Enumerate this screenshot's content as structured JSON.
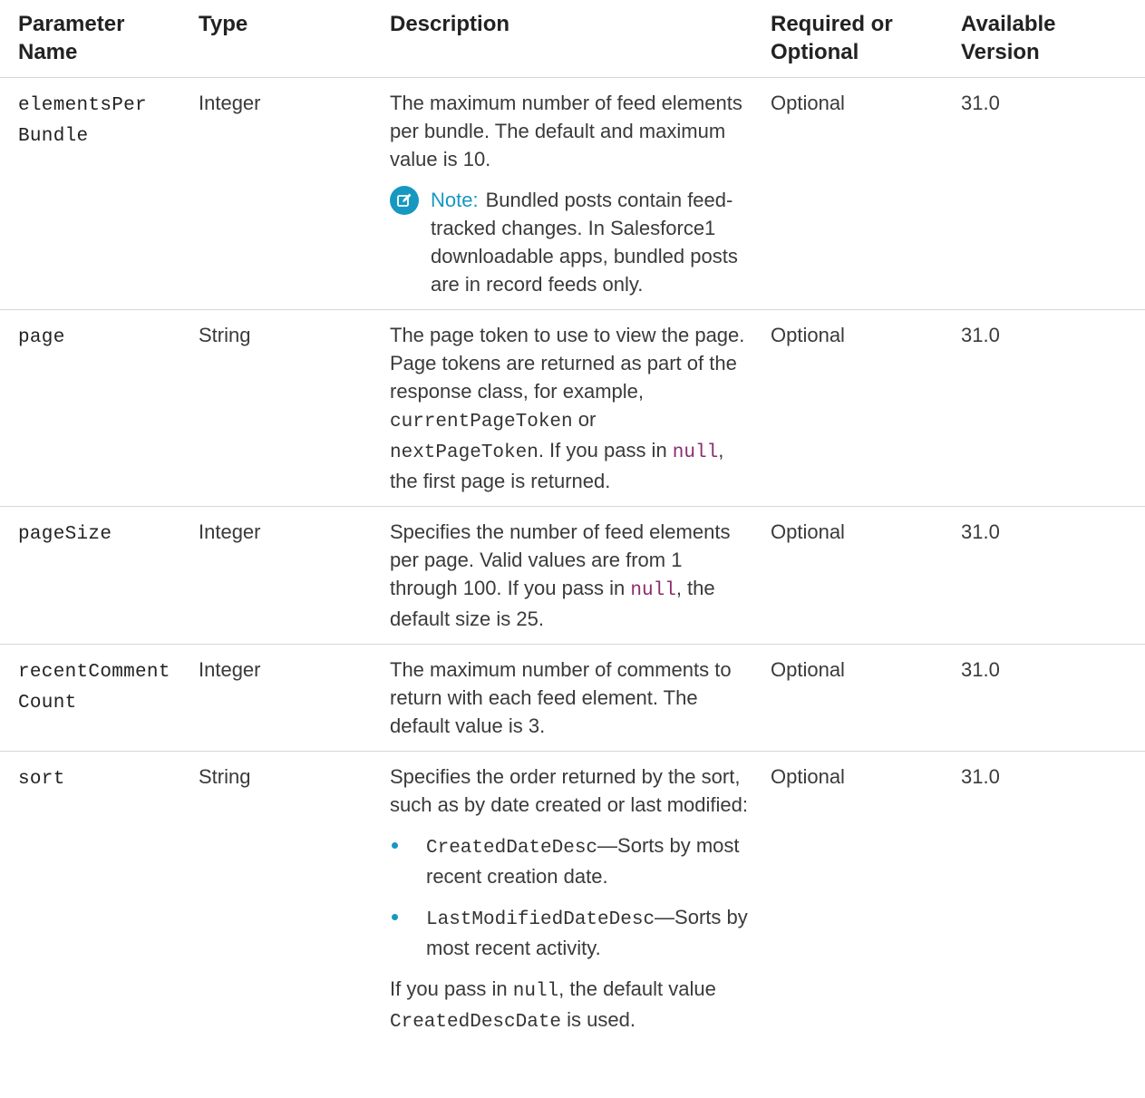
{
  "headers": {
    "name": "Parameter Name",
    "type": "Type",
    "description": "Description",
    "required": "Required or Optional",
    "version": "Available Version"
  },
  "rows": [
    {
      "name_parts": [
        "elementsPer",
        "Bundle"
      ],
      "type": "Integer",
      "desc": "The maximum number of feed elements per bundle. The default and maximum value is 10.",
      "note_label": "Note:",
      "note_text": "Bundled posts contain feed-tracked changes. In Salesforce1 downloadable apps, bundled posts are in record feeds only.",
      "required": "Optional",
      "version": "31.0"
    },
    {
      "name": "page",
      "type": "String",
      "desc_a": "The page token to use to view the page. Page tokens are returned as part of the response class, for example, ",
      "code_1": "currentPageToken",
      "desc_b": " or ",
      "code_2": "nextPageToken",
      "desc_c": ". If you pass in ",
      "code_null": "null",
      "desc_d": ", the first page is returned.",
      "required": "Optional",
      "version": "31.0"
    },
    {
      "name": "pageSize",
      "type": "Integer",
      "desc_a": "Specifies the number of feed elements per page. Valid values are from 1 through 100. If you pass in ",
      "code_null": "null",
      "desc_b": ", the default size is 25.",
      "required": "Optional",
      "version": "31.0"
    },
    {
      "name_parts": [
        "recentComment",
        "Count"
      ],
      "type": "Integer",
      "desc": "The maximum number of comments to return with each feed element. The default value is 3.",
      "required": "Optional",
      "version": "31.0"
    },
    {
      "name": "sort",
      "type": "String",
      "desc_intro": "Specifies the order returned by the sort, such as by date created or last modified:",
      "options": [
        {
          "code": "CreatedDateDesc",
          "text": "—Sorts by most recent creation date."
        },
        {
          "code": "LastModifiedDateDesc",
          "text": "—Sorts by most recent activity."
        }
      ],
      "desc_outro_a": "If you pass in ",
      "code_null": "null",
      "desc_outro_b": ", the default value ",
      "code_default": "CreatedDescDate",
      "desc_outro_c": " is used.",
      "required": "Optional",
      "version": "31.0"
    }
  ],
  "colors": {
    "accent": "#1798c1",
    "null_code": "#8b2c6e",
    "rule": "#d6d6d6"
  },
  "icons": {
    "note": "edit-note-icon"
  }
}
